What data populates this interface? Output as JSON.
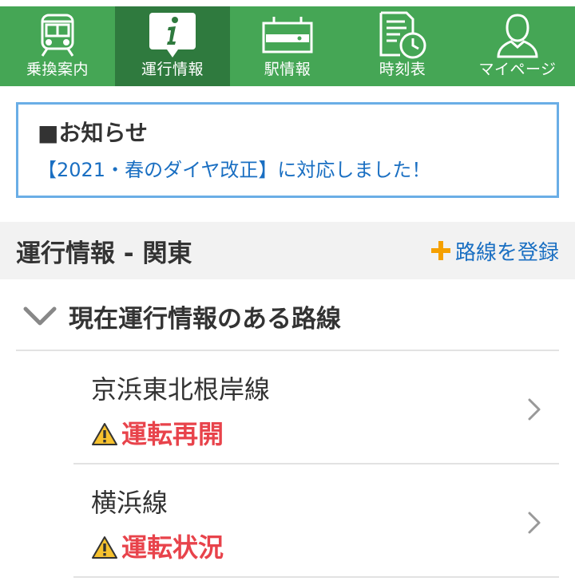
{
  "nav": {
    "items": [
      {
        "label": "乗換案内",
        "icon": "train-icon",
        "active": false
      },
      {
        "label": "運行情報",
        "icon": "info-icon",
        "active": true
      },
      {
        "label": "駅情報",
        "icon": "station-sign-icon",
        "active": false
      },
      {
        "label": "時刻表",
        "icon": "timetable-clock-icon",
        "active": false
      },
      {
        "label": "マイページ",
        "icon": "user-icon",
        "active": false
      }
    ]
  },
  "notice": {
    "title": "■お知らせ",
    "link_text": "【2021・春のダイヤ改正】に対応しました！"
  },
  "section": {
    "title": "運行情報 - 関東",
    "register_label": "路線を登録"
  },
  "group": {
    "title": "現在運行情報のある路線",
    "lines": [
      {
        "name": "京浜東北根岸線",
        "status": "運転再開"
      },
      {
        "name": "横浜線",
        "status": "運転状況"
      }
    ]
  },
  "colors": {
    "nav_bg": "#45a655",
    "nav_active_bg": "#2f7a3e",
    "link": "#1a6fc2",
    "alert": "#e8434b",
    "plus": "#f5a000",
    "warning_fill": "#f6c12e"
  }
}
